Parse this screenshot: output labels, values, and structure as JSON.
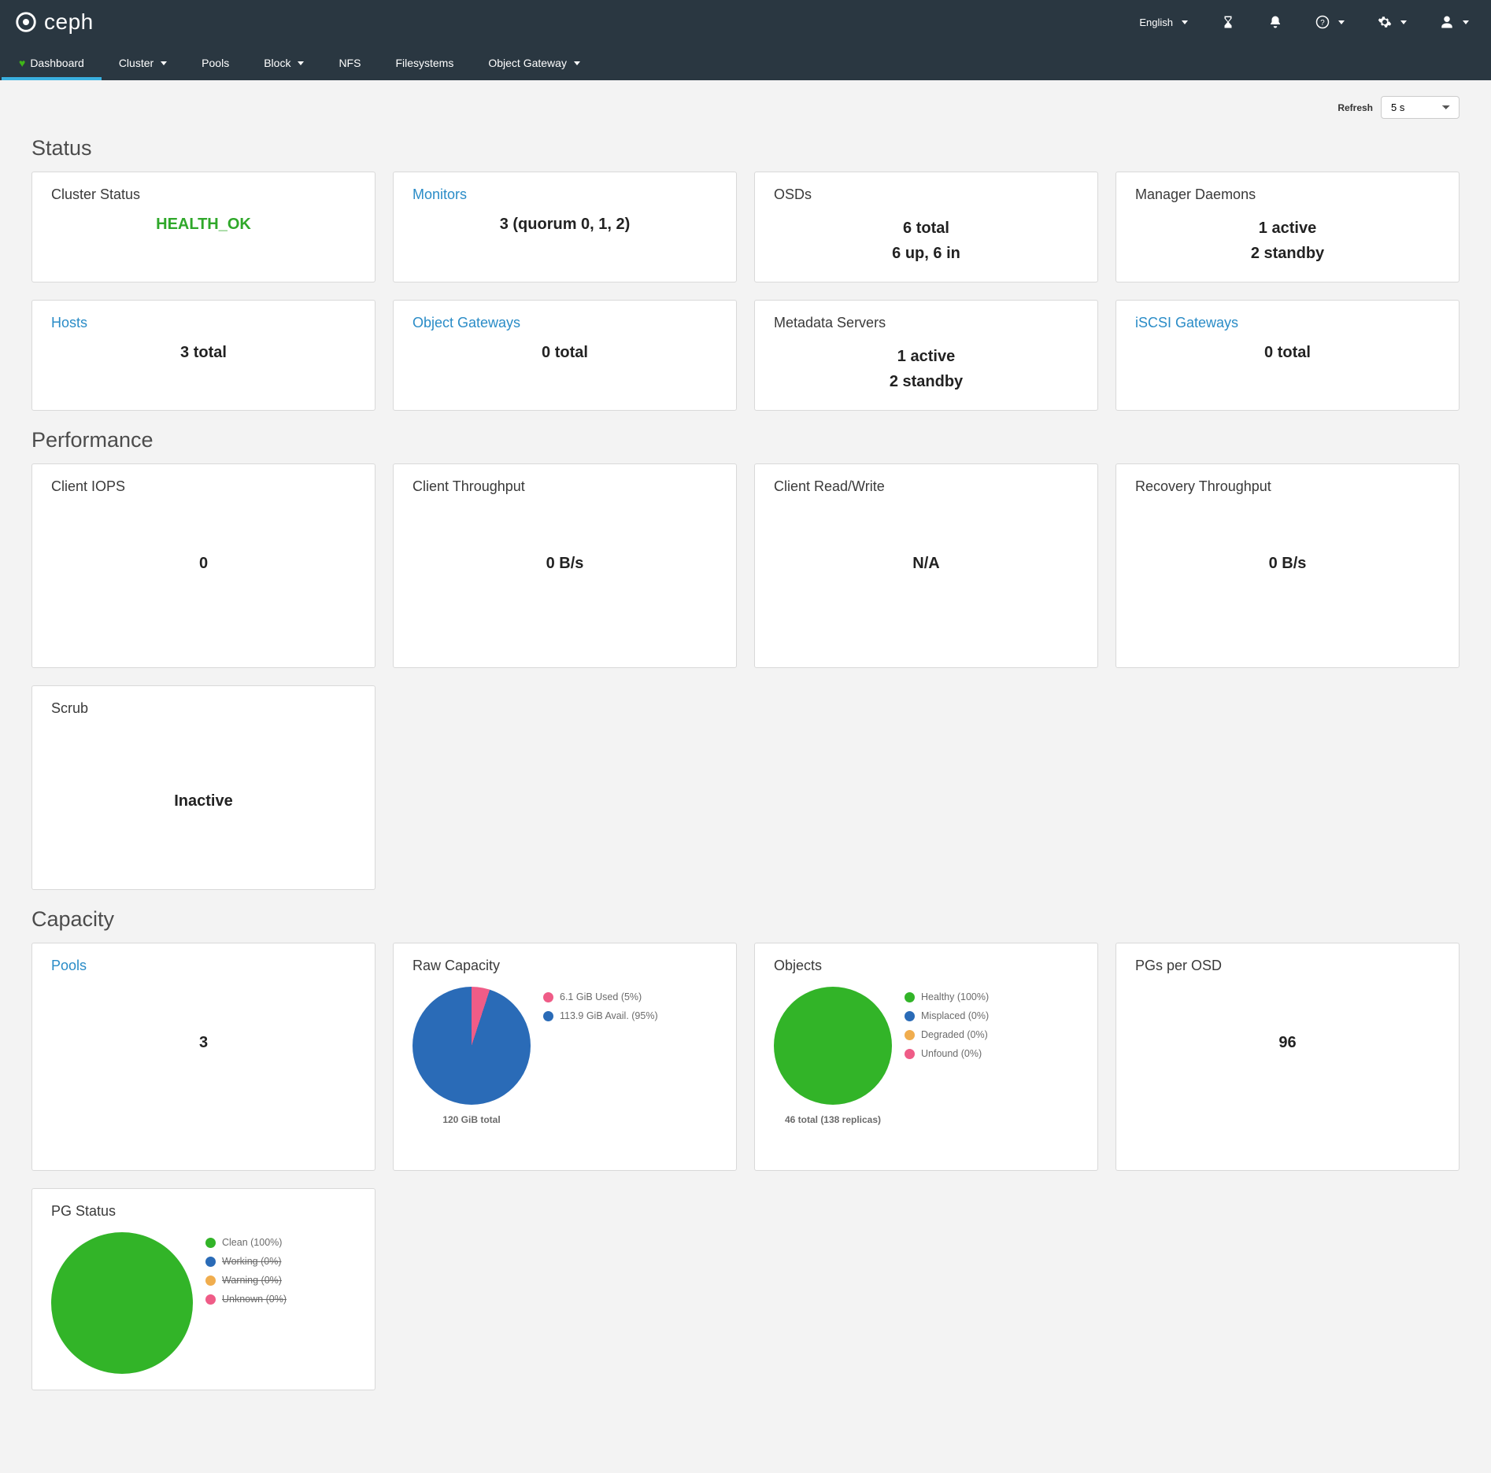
{
  "brand": "ceph",
  "top_right": {
    "language": "English"
  },
  "nav": {
    "dashboard": "Dashboard",
    "cluster": "Cluster",
    "pools": "Pools",
    "block": "Block",
    "nfs": "NFS",
    "filesystems": "Filesystems",
    "object_gateway": "Object Gateway"
  },
  "refresh": {
    "label": "Refresh",
    "value": "5 s",
    "options": [
      "5 s"
    ]
  },
  "sections": {
    "status": "Status",
    "performance": "Performance",
    "capacity": "Capacity"
  },
  "status": {
    "cluster_status": {
      "title": "Cluster Status",
      "value": "HEALTH_OK",
      "link": false
    },
    "monitors": {
      "title": "Monitors",
      "value": "3 (quorum 0, 1, 2)",
      "link": true
    },
    "osds": {
      "title": "OSDs",
      "line1": "6 total",
      "line2": "6 up, 6 in",
      "link": false
    },
    "managers": {
      "title": "Manager Daemons",
      "line1": "1 active",
      "line2": "2 standby",
      "link": false
    },
    "hosts": {
      "title": "Hosts",
      "value": "3 total",
      "link": true
    },
    "obj_gateways": {
      "title": "Object Gateways",
      "value": "0 total",
      "link": true
    },
    "mds": {
      "title": "Metadata Servers",
      "line1": "1 active",
      "line2": "2 standby",
      "link": false
    },
    "iscsi": {
      "title": "iSCSI Gateways",
      "value": "0 total",
      "link": true
    }
  },
  "performance": {
    "client_iops": {
      "title": "Client IOPS",
      "value": "0"
    },
    "client_throughput": {
      "title": "Client Throughput",
      "value": "0 B/s"
    },
    "client_rw": {
      "title": "Client Read/Write",
      "value": "N/A"
    },
    "recovery": {
      "title": "Recovery Throughput",
      "value": "0 B/s"
    },
    "scrub": {
      "title": "Scrub",
      "value": "Inactive"
    }
  },
  "capacity": {
    "pools": {
      "title": "Pools",
      "value": "3",
      "link": true
    },
    "raw": {
      "title": "Raw Capacity",
      "caption": "120 GiB total"
    },
    "objects": {
      "title": "Objects",
      "caption": "46 total (138 replicas)"
    },
    "pgs_per_osd": {
      "title": "PGs per OSD",
      "value": "96"
    },
    "pg_status": {
      "title": "PG Status"
    }
  },
  "chart_data": [
    {
      "id": "raw_capacity",
      "type": "pie",
      "title": "Raw Capacity",
      "caption": "120 GiB total",
      "series": [
        {
          "name": "6.1 GiB Used (5%)",
          "value": 5,
          "color": "#ef5c87"
        },
        {
          "name": "113.9 GiB Avail. (95%)",
          "value": 95,
          "color": "#2a6bb7"
        }
      ]
    },
    {
      "id": "objects",
      "type": "pie",
      "title": "Objects",
      "caption": "46 total (138 replicas)",
      "series": [
        {
          "name": "Healthy (100%)",
          "value": 100,
          "color": "#32b428"
        },
        {
          "name": "Misplaced (0%)",
          "value": 0,
          "color": "#2a6bb7"
        },
        {
          "name": "Degraded (0%)",
          "value": 0,
          "color": "#f0ad4e"
        },
        {
          "name": "Unfound (0%)",
          "value": 0,
          "color": "#ef5c87"
        }
      ]
    },
    {
      "id": "pg_status",
      "type": "pie",
      "title": "PG Status",
      "series": [
        {
          "name": "Clean (100%)",
          "value": 100,
          "color": "#32b428",
          "strike": false
        },
        {
          "name": "Working (0%)",
          "value": 0,
          "color": "#2a6bb7",
          "strike": true
        },
        {
          "name": "Warning (0%)",
          "value": 0,
          "color": "#f0ad4e",
          "strike": true
        },
        {
          "name": "Unknown (0%)",
          "value": 0,
          "color": "#ef5c87",
          "strike": true
        }
      ]
    }
  ]
}
